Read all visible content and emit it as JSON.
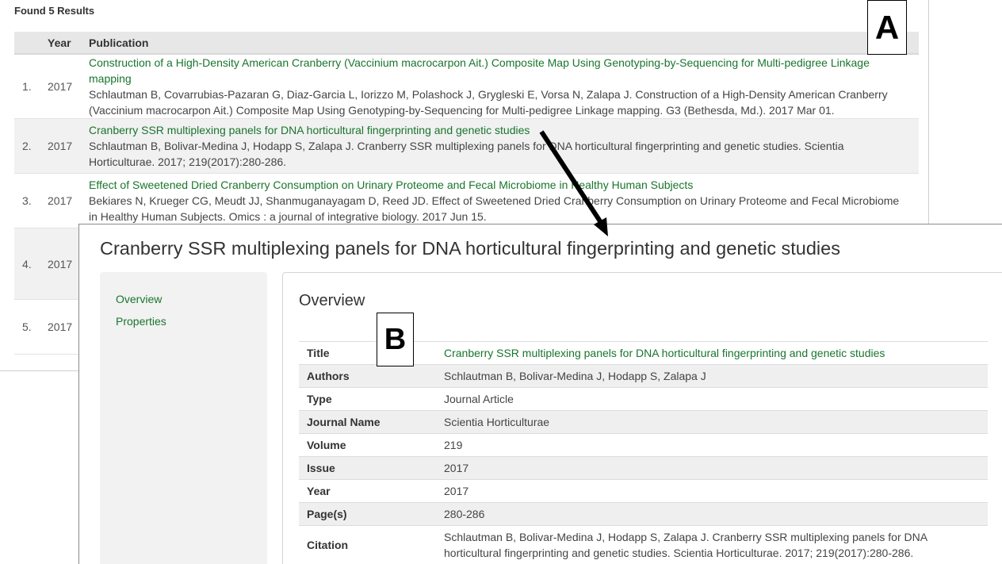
{
  "labels": {
    "a": "A",
    "b": "B"
  },
  "results": {
    "found_text": "Found 5 Results",
    "headers": {
      "num": "",
      "year": "Year",
      "publication": "Publication"
    },
    "rows": [
      {
        "num": "1.",
        "year": "2017",
        "title": "Construction of a High-Density American Cranberry (Vaccinium macrocarpon Ait.) Composite Map Using Genotyping-by-Sequencing for Multi-pedigree Linkage mapping",
        "citation": "Schlautman B, Covarrubias-Pazaran G, Diaz-Garcia L, Iorizzo M, Polashock J, Grygleski E, Vorsa N, Zalapa J. Construction of a High-Density American Cranberry (Vaccinium macrocarpon Ait.) Composite Map Using Genotyping-by-Sequencing for Multi-pedigree Linkage mapping. G3 (Bethesda, Md.). 2017 Mar 01."
      },
      {
        "num": "2.",
        "year": "2017",
        "title": "Cranberry SSR multiplexing panels for DNA horticultural fingerprinting and genetic studies",
        "citation": "Schlautman B, Bolivar-Medina J, Hodapp S, Zalapa J. Cranberry SSR multiplexing panels for DNA horticultural fingerprinting and genetic studies. Scientia Horticulturae. 2017; 219(2017):280-286."
      },
      {
        "num": "3.",
        "year": "2017",
        "title": "Effect of Sweetened Dried Cranberry Consumption on Urinary Proteome and Fecal Microbiome in Healthy Human Subjects",
        "citation": "Bekiares N, Krueger CG, Meudt JJ, Shanmuganayagam D, Reed JD. Effect of Sweetened Dried Cranberry Consumption on Urinary Proteome and Fecal Microbiome in Healthy Human Subjects. Omics : a journal of integrative biology. 2017 Jun 15."
      },
      {
        "num": "4.",
        "year": "2017",
        "title": "",
        "citation": ""
      },
      {
        "num": "5.",
        "year": "2017",
        "title": "",
        "citation": ""
      }
    ]
  },
  "detail": {
    "title": "Cranberry SSR multiplexing panels for DNA horticultural fingerprinting and genetic studies",
    "sidebar": [
      "Overview",
      "Properties"
    ],
    "overview_heading": "Overview",
    "rows": [
      {
        "key": "Title",
        "value": "Cranberry SSR multiplexing panels for DNA horticultural fingerprinting and genetic studies"
      },
      {
        "key": "Authors",
        "value": "Schlautman B, Bolivar-Medina J, Hodapp S, Zalapa J"
      },
      {
        "key": "Type",
        "value": "Journal Article"
      },
      {
        "key": "Journal Name",
        "value": "Scientia Horticulturae"
      },
      {
        "key": "Volume",
        "value": "219"
      },
      {
        "key": "Issue",
        "value": "2017"
      },
      {
        "key": "Year",
        "value": "2017"
      },
      {
        "key": "Page(s)",
        "value": "280-286"
      },
      {
        "key": "Citation",
        "value": "Schlautman B, Bolivar-Medina J, Hodapp S, Zalapa J. Cranberry SSR multiplexing panels for DNA horticultural fingerprinting and genetic studies. Scientia Horticulturae. 2017; 219(2017):280-286."
      }
    ]
  },
  "colors": {
    "link": "#19752c",
    "header_bg": "#e7e7e7",
    "stripe": "#f1f1f1"
  }
}
